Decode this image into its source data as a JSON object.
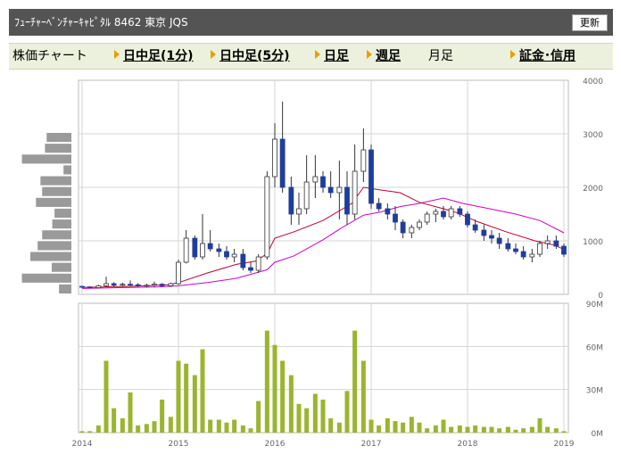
{
  "header": {
    "title": "ﾌｭｰﾁｬｰﾍﾞﾝﾁｬｰｷｬﾋﾟﾀﾙ 8462 東京 JQS",
    "update_label": "更新"
  },
  "nav": {
    "label": "株価チャート",
    "intraday1": "日中足(1分)",
    "intraday5": "日中足(5分)",
    "daily": "日足",
    "weekly": "週足",
    "monthly": "月足",
    "margin": "証金･信用"
  },
  "colors": {
    "up_candle": "#ffffff",
    "down_candle": "#1e3e9c",
    "ma_short": "#c0002e",
    "ma_long": "#cc00cc",
    "volume": "#9ab52e",
    "volume_profile": "#9a9a9a"
  },
  "chart_data": [
    {
      "type": "candlestick",
      "ylim": [
        0,
        4000
      ],
      "yticks": [
        "0",
        "1000",
        "2000",
        "3000",
        "4000"
      ],
      "xticks": [
        "2014",
        "2015",
        "2016",
        "2017",
        "2018",
        "2019"
      ],
      "x_range": [
        2014.0,
        2019.0
      ],
      "series": [
        {
          "values": [
            [
              2014.0,
              150,
              160,
              120,
              140
            ],
            [
              2014.08,
              140,
              150,
              115,
              125
            ],
            [
              2014.17,
              125,
              180,
              110,
              160
            ],
            [
              2014.25,
              160,
              330,
              140,
              200
            ],
            [
              2014.33,
              200,
              230,
              150,
              170
            ],
            [
              2014.42,
              170,
              220,
              140,
              190
            ],
            [
              2014.5,
              190,
              260,
              150,
              180
            ],
            [
              2014.58,
              180,
              210,
              140,
              160
            ],
            [
              2014.67,
              160,
              200,
              130,
              170
            ],
            [
              2014.75,
              170,
              240,
              140,
              190
            ],
            [
              2014.83,
              190,
              210,
              150,
              160
            ],
            [
              2014.92,
              160,
              220,
              140,
              200
            ],
            [
              2015.0,
              200,
              650,
              180,
              600
            ],
            [
              2015.08,
              600,
              1200,
              580,
              1050
            ],
            [
              2015.17,
              1050,
              1100,
              650,
              700
            ],
            [
              2015.25,
              700,
              1500,
              650,
              950
            ],
            [
              2015.33,
              950,
              1200,
              800,
              850
            ],
            [
              2015.42,
              850,
              950,
              700,
              800
            ],
            [
              2015.5,
              800,
              900,
              650,
              700
            ],
            [
              2015.58,
              700,
              850,
              600,
              750
            ],
            [
              2015.67,
              750,
              850,
              450,
              500
            ],
            [
              2015.75,
              500,
              600,
              400,
              450
            ],
            [
              2015.83,
              450,
              750,
              400,
              700
            ],
            [
              2015.92,
              700,
              2300,
              650,
              2200
            ],
            [
              2016.0,
              2200,
              3200,
              2000,
              2900
            ],
            [
              2016.08,
              2900,
              3600,
              1900,
              2000
            ],
            [
              2016.17,
              2000,
              2200,
              1300,
              1500
            ],
            [
              2016.25,
              1500,
              1900,
              1300,
              1600
            ],
            [
              2016.33,
              1600,
              2600,
              1500,
              2100
            ],
            [
              2016.42,
              2100,
              2600,
              1800,
              2200
            ],
            [
              2016.5,
              2200,
              2300,
              1900,
              2000
            ],
            [
              2016.58,
              2000,
              2300,
              1800,
              1900
            ],
            [
              2016.67,
              1900,
              2500,
              1400,
              2000
            ],
            [
              2016.75,
              2000,
              2300,
              1300,
              1500
            ],
            [
              2016.83,
              1500,
              2800,
              1400,
              2300
            ],
            [
              2016.92,
              2300,
              3100,
              2100,
              2700
            ],
            [
              2017.0,
              2700,
              2800,
              1600,
              1700
            ],
            [
              2017.08,
              1700,
              1800,
              1550,
              1600
            ],
            [
              2017.17,
              1600,
              1700,
              1400,
              1500
            ],
            [
              2017.25,
              1500,
              1650,
              1200,
              1350
            ],
            [
              2017.33,
              1350,
              1400,
              1050,
              1150
            ],
            [
              2017.42,
              1150,
              1300,
              1050,
              1250
            ],
            [
              2017.5,
              1250,
              1400,
              1200,
              1350
            ],
            [
              2017.58,
              1350,
              1550,
              1300,
              1500
            ],
            [
              2017.67,
              1500,
              1600,
              1350,
              1550
            ],
            [
              2017.75,
              1550,
              1650,
              1400,
              1450
            ],
            [
              2017.83,
              1450,
              1650,
              1400,
              1600
            ],
            [
              2017.92,
              1600,
              1650,
              1450,
              1500
            ],
            [
              2018.0,
              1500,
              1550,
              1250,
              1300
            ],
            [
              2018.08,
              1300,
              1400,
              1150,
              1200
            ],
            [
              2018.17,
              1200,
              1300,
              1000,
              1100
            ],
            [
              2018.25,
              1100,
              1200,
              950,
              1050
            ],
            [
              2018.33,
              1050,
              1150,
              850,
              950
            ],
            [
              2018.42,
              950,
              1050,
              800,
              850
            ],
            [
              2018.5,
              850,
              950,
              750,
              800
            ],
            [
              2018.58,
              800,
              900,
              650,
              700
            ],
            [
              2018.67,
              700,
              850,
              600,
              750
            ],
            [
              2018.75,
              750,
              1000,
              700,
              950
            ],
            [
              2018.83,
              950,
              1100,
              850,
              1000
            ],
            [
              2018.92,
              1000,
              1100,
              850,
              900
            ],
            [
              2019.0,
              900,
              950,
              700,
              750
            ],
            [
              2019.08,
              750,
              800,
              500,
              550
            ],
            [
              2019.17,
              550,
              700,
              500,
              650
            ]
          ]
        },
        {
          "values": [
            [
              2014.0,
              130
            ],
            [
              2014.5,
              150
            ],
            [
              2014.9,
              180
            ],
            [
              2015.0,
              220
            ],
            [
              2015.3,
              400
            ],
            [
              2015.6,
              560
            ],
            [
              2015.8,
              620
            ],
            [
              2015.92,
              760
            ],
            [
              2016.0,
              1050
            ],
            [
              2016.2,
              1170
            ],
            [
              2016.5,
              1380
            ],
            [
              2016.8,
              1700
            ],
            [
              2016.92,
              2000
            ],
            [
              2017.1,
              1950
            ],
            [
              2017.3,
              1900
            ],
            [
              2017.5,
              1720
            ],
            [
              2017.75,
              1600
            ],
            [
              2017.9,
              1520
            ],
            [
              2018.1,
              1360
            ],
            [
              2018.4,
              1170
            ],
            [
              2018.7,
              1000
            ],
            [
              2018.9,
              920
            ],
            [
              2019.0,
              840
            ]
          ]
        },
        {
          "values": [
            [
              2014.0,
              110
            ],
            [
              2014.5,
              130
            ],
            [
              2014.8,
              140
            ],
            [
              2015.0,
              160
            ],
            [
              2015.3,
              220
            ],
            [
              2015.6,
              300
            ],
            [
              2015.8,
              400
            ],
            [
              2015.92,
              460
            ],
            [
              2016.0,
              600
            ],
            [
              2016.2,
              720
            ],
            [
              2016.5,
              1020
            ],
            [
              2016.7,
              1250
            ],
            [
              2016.92,
              1480
            ],
            [
              2017.1,
              1540
            ],
            [
              2017.3,
              1640
            ],
            [
              2017.5,
              1700
            ],
            [
              2017.75,
              1800
            ],
            [
              2017.95,
              1700
            ],
            [
              2018.2,
              1610
            ],
            [
              2018.5,
              1500
            ],
            [
              2018.75,
              1380
            ],
            [
              2019.0,
              1150
            ]
          ]
        }
      ]
    },
    {
      "type": "bar",
      "ylim": [
        0,
        90
      ],
      "yticks": [
        "0M",
        "30M",
        "60M",
        "90M"
      ],
      "xticks": [
        "2014",
        "2015",
        "2016",
        "2017",
        "2018",
        "2019"
      ],
      "x_range": [
        2014.0,
        2019.0
      ],
      "x": [
        2014.0,
        2014.08,
        2014.17,
        2014.25,
        2014.33,
        2014.42,
        2014.5,
        2014.58,
        2014.67,
        2014.75,
        2014.83,
        2014.92,
        2015.0,
        2015.08,
        2015.17,
        2015.25,
        2015.33,
        2015.42,
        2015.5,
        2015.58,
        2015.67,
        2015.75,
        2015.83,
        2015.92,
        2016.0,
        2016.08,
        2016.17,
        2016.25,
        2016.33,
        2016.42,
        2016.5,
        2016.58,
        2016.67,
        2016.75,
        2016.83,
        2016.92,
        2017.0,
        2017.08,
        2017.17,
        2017.25,
        2017.33,
        2017.42,
        2017.5,
        2017.58,
        2017.67,
        2017.75,
        2017.83,
        2017.92,
        2018.0,
        2018.08,
        2018.17,
        2018.25,
        2018.33,
        2018.42,
        2018.5,
        2018.58,
        2018.67,
        2018.75,
        2018.83,
        2018.92,
        2019.0
      ],
      "values": [
        1,
        1,
        5,
        50,
        17,
        10,
        28,
        5,
        6,
        8,
        23,
        11,
        50,
        48,
        40,
        58,
        9,
        9,
        7,
        9,
        5,
        3,
        22,
        71,
        61,
        50,
        40,
        20,
        17,
        27,
        23,
        10,
        7,
        29,
        71,
        50,
        9,
        5,
        10,
        8,
        7,
        11,
        7,
        3,
        5,
        9,
        4,
        5,
        4,
        5,
        4,
        4,
        3,
        4,
        2,
        3,
        4,
        10,
        4,
        3,
        1
      ]
    }
  ],
  "volume_profile": [
    0.44,
    0.47,
    0.88,
    0.14,
    0.55,
    0.52,
    0.63,
    0.3,
    0.34,
    0.52,
    0.6,
    0.73,
    0.35,
    0.88,
    0.22
  ]
}
